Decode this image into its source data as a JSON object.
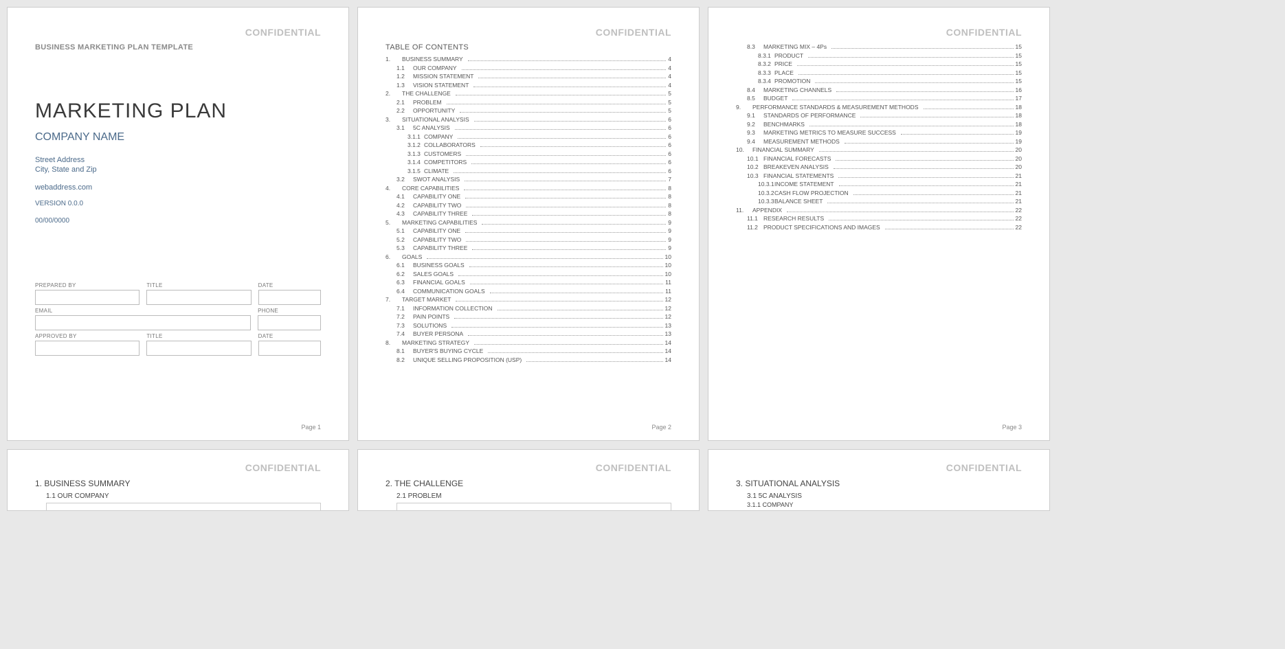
{
  "confidential": "CONFIDENTIAL",
  "template_label": "BUSINESS MARKETING PLAN TEMPLATE",
  "cover": {
    "title": "MARKETING PLAN",
    "company": "COMPANY NAME",
    "street": "Street Address",
    "city": "City, State and Zip",
    "web": "webaddress.com",
    "version": "VERSION 0.0.0",
    "date": "00/00/0000",
    "labels": {
      "prepared_by": "PREPARED BY",
      "title": "TITLE",
      "date": "DATE",
      "email": "EMAIL",
      "phone": "PHONE",
      "approved_by": "APPROVED BY"
    }
  },
  "page_label": {
    "p1": "Page 1",
    "p2": "Page 2",
    "p3": "Page 3"
  },
  "toc_title": "TABLE OF CONTENTS",
  "toc_p2": [
    {
      "n": "1.",
      "t": "BUSINESS SUMMARY",
      "p": "4",
      "l": 1
    },
    {
      "n": "1.1",
      "t": "OUR COMPANY",
      "p": "4",
      "l": 2
    },
    {
      "n": "1.2",
      "t": "MISSION STATEMENT",
      "p": "4",
      "l": 2
    },
    {
      "n": "1.3",
      "t": "VISION STATEMENT",
      "p": "4",
      "l": 2
    },
    {
      "n": "2.",
      "t": "THE CHALLENGE",
      "p": "5",
      "l": 1
    },
    {
      "n": "2.1",
      "t": "PROBLEM",
      "p": "5",
      "l": 2
    },
    {
      "n": "2.2",
      "t": "OPPORTUNITY",
      "p": "5",
      "l": 2
    },
    {
      "n": "3.",
      "t": "SITUATIONAL ANALYSIS",
      "p": "6",
      "l": 1
    },
    {
      "n": "3.1",
      "t": "5C ANALYSIS",
      "p": "6",
      "l": 2
    },
    {
      "n": "3.1.1",
      "t": "COMPANY",
      "p": "6",
      "l": 3
    },
    {
      "n": "3.1.2",
      "t": "COLLABORATORS",
      "p": "6",
      "l": 3
    },
    {
      "n": "3.1.3",
      "t": "CUSTOMERS",
      "p": "6",
      "l": 3
    },
    {
      "n": "3.1.4",
      "t": "COMPETITORS",
      "p": "6",
      "l": 3
    },
    {
      "n": "3.1.5",
      "t": "CLIMATE",
      "p": "6",
      "l": 3
    },
    {
      "n": "3.2",
      "t": "SWOT ANALYSIS",
      "p": "7",
      "l": 2
    },
    {
      "n": "4.",
      "t": "CORE CAPABILITIES",
      "p": "8",
      "l": 1
    },
    {
      "n": "4.1",
      "t": "CAPABILITY ONE",
      "p": "8",
      "l": 2
    },
    {
      "n": "4.2",
      "t": "CAPABILITY TWO",
      "p": "8",
      "l": 2
    },
    {
      "n": "4.3",
      "t": "CAPABILITY THREE",
      "p": "8",
      "l": 2
    },
    {
      "n": "5.",
      "t": "MARKETING CAPABILITIES",
      "p": "9",
      "l": 1
    },
    {
      "n": "5.1",
      "t": "CAPABILITY ONE",
      "p": "9",
      "l": 2
    },
    {
      "n": "5.2",
      "t": "CAPABILITY TWO",
      "p": "9",
      "l": 2
    },
    {
      "n": "5.3",
      "t": "CAPABILITY THREE",
      "p": "9",
      "l": 2
    },
    {
      "n": "6.",
      "t": "GOALS",
      "p": "10",
      "l": 1
    },
    {
      "n": "6.1",
      "t": "BUSINESS GOALS",
      "p": "10",
      "l": 2
    },
    {
      "n": "6.2",
      "t": "SALES GOALS",
      "p": "10",
      "l": 2
    },
    {
      "n": "6.3",
      "t": "FINANCIAL GOALS",
      "p": "11",
      "l": 2
    },
    {
      "n": "6.4",
      "t": "COMMUNICATION GOALS",
      "p": "11",
      "l": 2
    },
    {
      "n": "7.",
      "t": "TARGET MARKET",
      "p": "12",
      "l": 1
    },
    {
      "n": "7.1",
      "t": "INFORMATION COLLECTION",
      "p": "12",
      "l": 2
    },
    {
      "n": "7.2",
      "t": "PAIN POINTS",
      "p": "12",
      "l": 2
    },
    {
      "n": "7.3",
      "t": "SOLUTIONS",
      "p": "13",
      "l": 2
    },
    {
      "n": "7.4",
      "t": "BUYER PERSONA",
      "p": "13",
      "l": 2
    },
    {
      "n": "8.",
      "t": "MARKETING STRATEGY",
      "p": "14",
      "l": 1
    },
    {
      "n": "8.1",
      "t": "BUYER'S BUYING CYCLE",
      "p": "14",
      "l": 2
    },
    {
      "n": "8.2",
      "t": "UNIQUE SELLING PROPOSITION (USP)",
      "p": "14",
      "l": 2
    }
  ],
  "toc_p3": [
    {
      "n": "8.3",
      "t": "MARKETING MIX – 4Ps",
      "p": "15",
      "l": 2
    },
    {
      "n": "8.3.1",
      "t": "PRODUCT",
      "p": "15",
      "l": 3
    },
    {
      "n": "8.3.2",
      "t": "PRICE",
      "p": "15",
      "l": 3
    },
    {
      "n": "8.3.3",
      "t": "PLACE",
      "p": "15",
      "l": 3
    },
    {
      "n": "8.3.4",
      "t": "PROMOTION",
      "p": "15",
      "l": 3
    },
    {
      "n": "8.4",
      "t": "MARKETING CHANNELS",
      "p": "16",
      "l": 2
    },
    {
      "n": "8.5",
      "t": "BUDGET",
      "p": "17",
      "l": 2
    },
    {
      "n": "9.",
      "t": "PERFORMANCE STANDARDS & MEASUREMENT METHODS",
      "p": "18",
      "l": 1
    },
    {
      "n": "9.1",
      "t": "STANDARDS OF PERFORMANCE",
      "p": "18",
      "l": 2
    },
    {
      "n": "9.2",
      "t": "BENCHMARKS",
      "p": "18",
      "l": 2
    },
    {
      "n": "9.3",
      "t": "MARKETING METRICS TO MEASURE SUCCESS",
      "p": "19",
      "l": 2
    },
    {
      "n": "9.4",
      "t": "MEASUREMENT METHODS",
      "p": "19",
      "l": 2
    },
    {
      "n": "10.",
      "t": "FINANCIAL SUMMARY",
      "p": "20",
      "l": 1
    },
    {
      "n": "10.1",
      "t": "FINANCIAL FORECASTS",
      "p": "20",
      "l": 2
    },
    {
      "n": "10.2",
      "t": "BREAKEVEN ANALYSIS",
      "p": "20",
      "l": 2
    },
    {
      "n": "10.3",
      "t": "FINANCIAL STATEMENTS",
      "p": "21",
      "l": 2
    },
    {
      "n": "10.3.1",
      "t": "INCOME STATEMENT",
      "p": "21",
      "l": 3
    },
    {
      "n": "10.3.2",
      "t": "CASH FLOW PROJECTION",
      "p": "21",
      "l": 3
    },
    {
      "n": "10.3.3",
      "t": "BALANCE SHEET",
      "p": "21",
      "l": 3
    },
    {
      "n": "11.",
      "t": "APPENDIX",
      "p": "22",
      "l": 1
    },
    {
      "n": "11.1",
      "t": "RESEARCH RESULTS",
      "p": "22",
      "l": 2
    },
    {
      "n": "11.2",
      "t": "PRODUCT SPECIFICATIONS AND IMAGES",
      "p": "22",
      "l": 2
    }
  ],
  "sections": {
    "p4": {
      "h": "1. BUSINESS SUMMARY",
      "s": "1.1  OUR COMPANY"
    },
    "p5": {
      "h": "2. THE CHALLENGE",
      "s": "2.1  PROBLEM"
    },
    "p6": {
      "h": "3. SITUATIONAL ANALYSIS",
      "s": "3.1  5C ANALYSIS",
      "ss": "3.1.1  COMPANY"
    }
  }
}
